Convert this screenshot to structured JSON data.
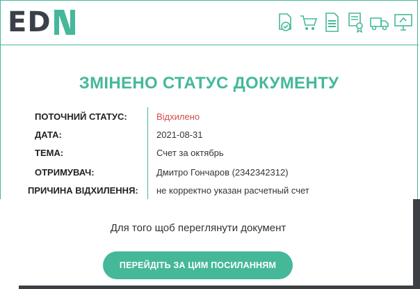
{
  "brand": {
    "logo_text": "ED",
    "logo_letter": "N",
    "accent": "#45b89a",
    "dark": "#3a4148"
  },
  "header_icons": [
    "document-check-icon",
    "cart-icon",
    "invoice-icon",
    "certificate-icon",
    "truck-icon",
    "monitor-icon"
  ],
  "title": "ЗМІНЕНО СТАТУС ДОКУМЕНТУ",
  "fields": [
    {
      "label": "ПОТОЧНИЙ СТАТУС:",
      "value": "Відхилено",
      "status_color": "#d94b4b"
    },
    {
      "label": "ДАТА:",
      "value": "2021-08-31"
    },
    {
      "label": "ТЕМА:",
      "value": "Счет за октябрь"
    },
    {
      "label": "ОТРИМУВАЧ:",
      "value": "Дмитро Гончаров (2342342312)"
    },
    {
      "label": "ПРИЧИНА ВІДХИЛЕННЯ:",
      "value": "не корректно указан расчетный счет"
    }
  ],
  "hint": "Для того щоб переглянути документ",
  "button_label": "ПЕРЕЙДІТЬ ЗА ЦИМ ПОСИЛАННЯМ"
}
